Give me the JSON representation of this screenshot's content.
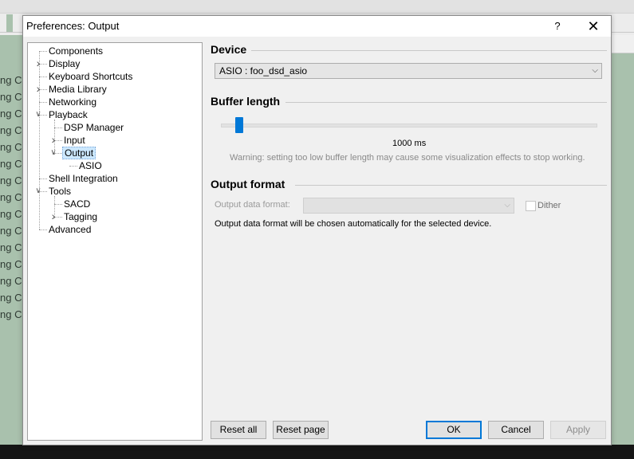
{
  "background": {
    "row_text": "ng C",
    "rows": 15
  },
  "dialog": {
    "title": "Preferences: Output",
    "help_label": "?",
    "close_label": "✕"
  },
  "tree": [
    {
      "label": "Components",
      "level": 0,
      "expander": "none"
    },
    {
      "label": "Display",
      "level": 0,
      "expander": "collapsed"
    },
    {
      "label": "Keyboard Shortcuts",
      "level": 0,
      "expander": "none"
    },
    {
      "label": "Media Library",
      "level": 0,
      "expander": "collapsed"
    },
    {
      "label": "Networking",
      "level": 0,
      "expander": "none"
    },
    {
      "label": "Playback",
      "level": 0,
      "expander": "expanded"
    },
    {
      "label": "DSP Manager",
      "level": 1,
      "expander": "none"
    },
    {
      "label": "Input",
      "level": 1,
      "expander": "collapsed"
    },
    {
      "label": "Output",
      "level": 1,
      "expander": "expanded",
      "selected": true
    },
    {
      "label": "ASIO",
      "level": 2,
      "expander": "none"
    },
    {
      "label": "Shell Integration",
      "level": 0,
      "expander": "none"
    },
    {
      "label": "Tools",
      "level": 0,
      "expander": "expanded"
    },
    {
      "label": "SACD",
      "level": 1,
      "expander": "none"
    },
    {
      "label": "Tagging",
      "level": 1,
      "expander": "collapsed"
    },
    {
      "label": "Advanced",
      "level": 0,
      "expander": "none"
    }
  ],
  "device": {
    "section_title": "Device",
    "selected": "ASIO : foo_dsd_asio"
  },
  "buffer": {
    "section_title": "Buffer length",
    "value_text": "1000 ms",
    "slider_fraction": 0.04,
    "warning": "Warning: setting too low buffer length may cause some visualization effects to stop working."
  },
  "output_format": {
    "section_title": "Output format",
    "data_format_label": "Output data format:",
    "data_format_value": "",
    "dither_label": "Dither",
    "dither_checked": false,
    "info": "Output data format will be chosen automatically for the selected device."
  },
  "buttons": {
    "reset_all": "Reset all",
    "reset_page": "Reset page",
    "ok": "OK",
    "cancel": "Cancel",
    "apply": "Apply"
  },
  "colors": {
    "accent": "#0078d7",
    "selection": "#cce8ff",
    "background_app": "#a9c1ad"
  }
}
